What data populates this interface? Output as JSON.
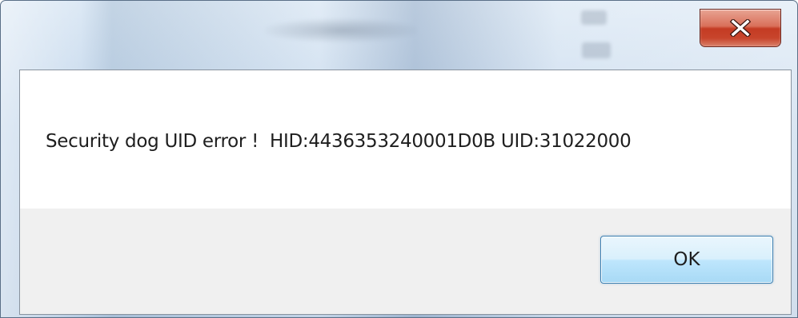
{
  "dialog": {
    "message": "Security dog UID error !  HID:4436353240001D0B UID:31022000",
    "ok_label": "OK"
  },
  "titlebar": {
    "close_icon": "close-icon"
  },
  "colors": {
    "close_button": "#c8452c",
    "ok_button_border": "#3c7fb1",
    "button_area": "#f0f0f0",
    "frame": "#c5d8ec"
  }
}
